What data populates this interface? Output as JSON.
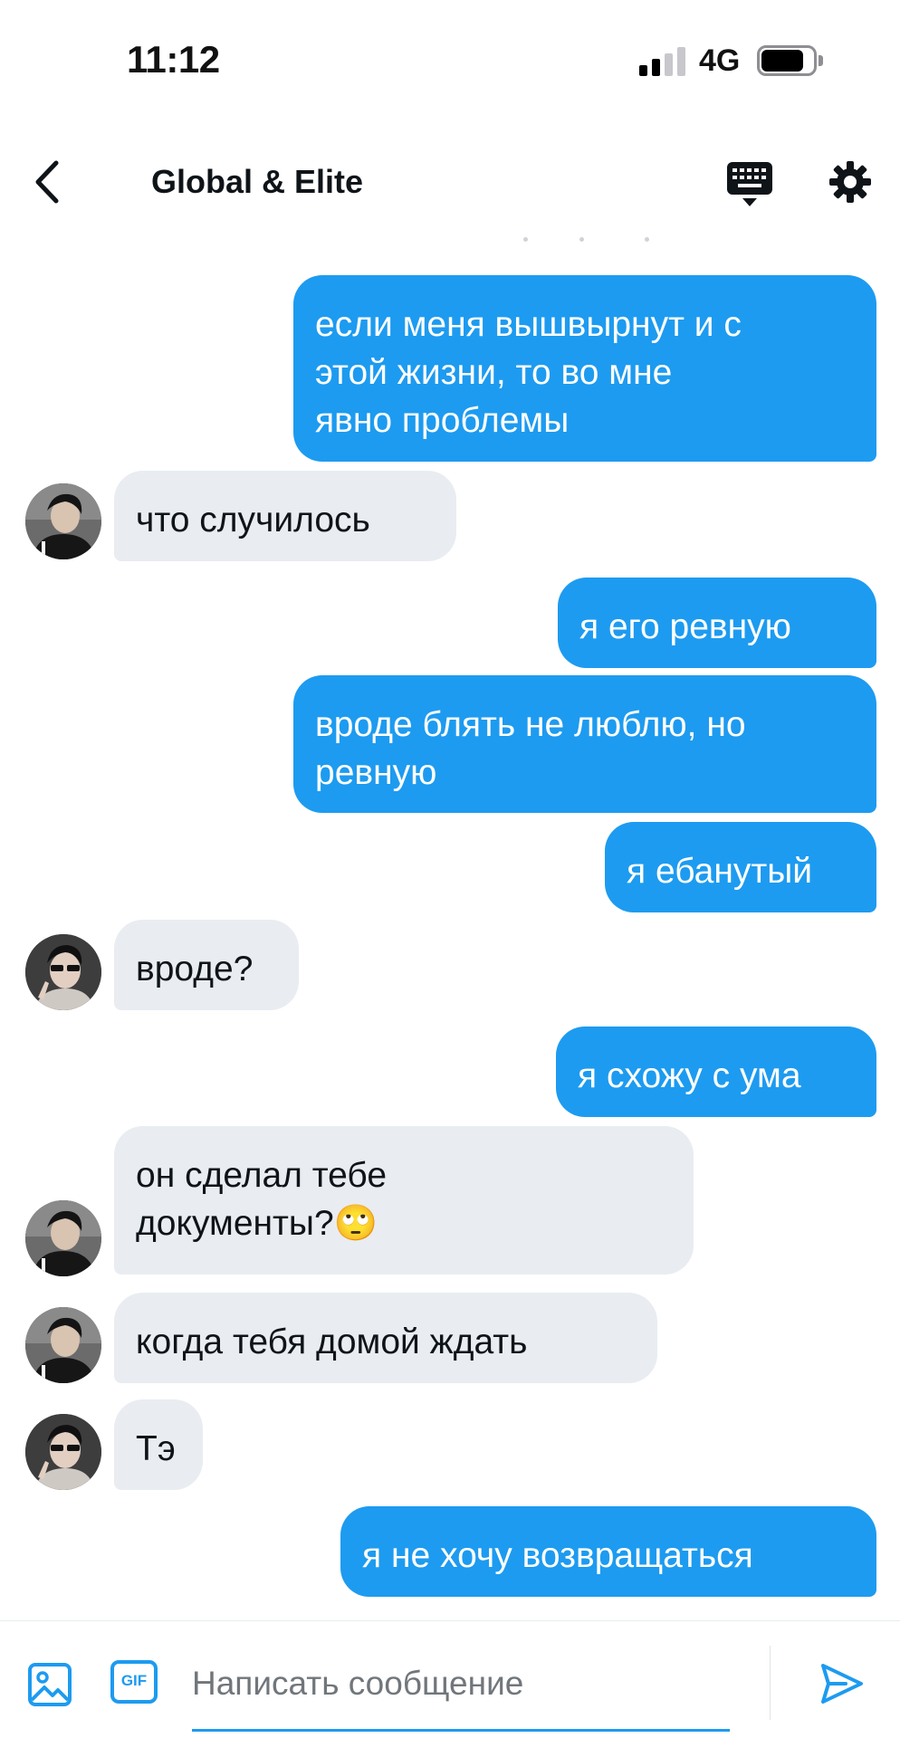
{
  "status_bar": {
    "time": "11:12",
    "network": "4G",
    "signal_bars_filled": 2,
    "signal_bars_total": 4,
    "battery_level": 0.75
  },
  "header": {
    "title": "Global & Elite",
    "back_icon": "chevron-left-icon",
    "keyboard_icon": "keyboard-icon",
    "settings_icon": "gear-icon"
  },
  "messages": [
    {
      "direction": "outgoing",
      "text": "если меня вышвырнут и с\nэтой жизни, то во мне\nявно проблемы"
    },
    {
      "direction": "incoming",
      "avatar": "avatar-hoodie",
      "text": "что случилось"
    },
    {
      "direction": "outgoing",
      "text": "я его ревную"
    },
    {
      "direction": "outgoing",
      "text": "вроде блять не люблю, но\nревную"
    },
    {
      "direction": "outgoing",
      "text": "я ебанутый"
    },
    {
      "direction": "incoming",
      "avatar": "avatar-sunglasses",
      "text": "вроде?"
    },
    {
      "direction": "outgoing",
      "text": "я схожу с ума"
    },
    {
      "direction": "incoming",
      "avatar": "avatar-hoodie",
      "text": "он сделал тебе\nдокументы?🙄"
    },
    {
      "direction": "incoming",
      "avatar": "avatar-hoodie",
      "text": "когда тебя домой ждать"
    },
    {
      "direction": "incoming",
      "avatar": "avatar-sunglasses",
      "text": "Тэ"
    },
    {
      "direction": "outgoing",
      "text": "я не хочу возвращаться"
    }
  ],
  "composer": {
    "placeholder": "Написать сообщение",
    "value": "",
    "gif_label": "GIF",
    "photo_icon": "image-icon",
    "send_icon": "send-icon"
  },
  "colors": {
    "accent": "#1d9bf0",
    "incoming_bubble": "#e9ecf1",
    "outgoing_text": "#ffffff",
    "placeholder": "#71767b"
  }
}
